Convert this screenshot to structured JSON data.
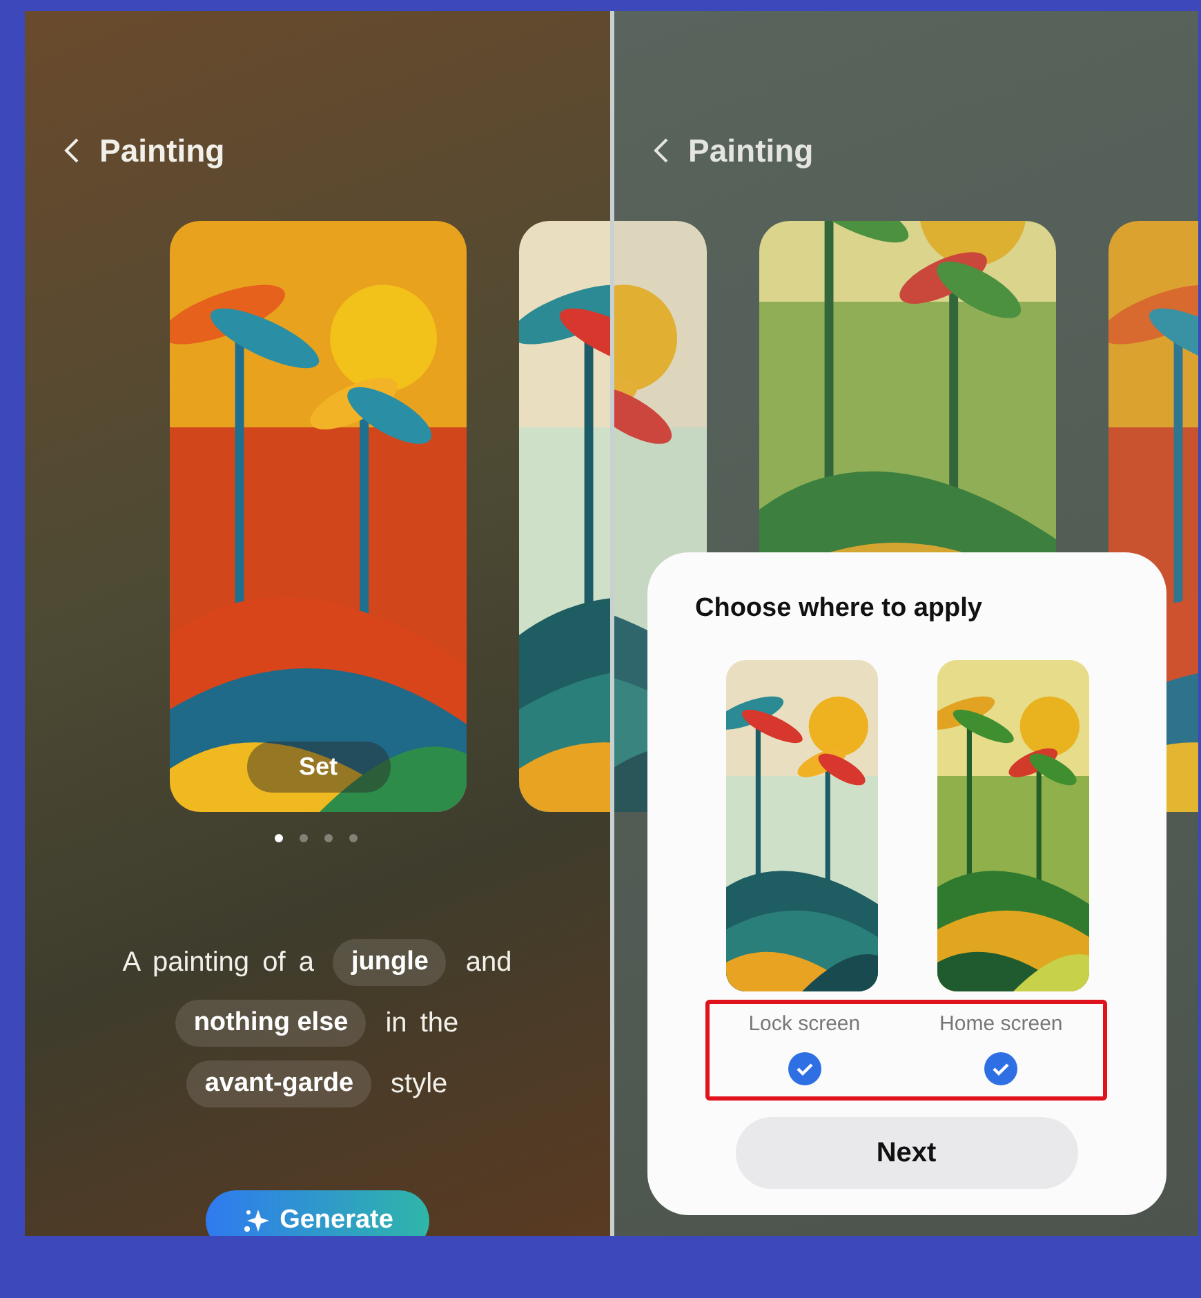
{
  "screens": [
    {
      "title": "Painting",
      "dimmed": false,
      "cards": [
        {
          "selected": true
        },
        {
          "selected": false
        }
      ],
      "set_button": "Set",
      "page_dots": [
        {
          "selected": true
        },
        {
          "selected": false
        },
        {
          "selected": false
        },
        {
          "selected": false
        }
      ],
      "prompt_lines": [
        [
          {
            "kind": "text",
            "text": "A painting of a"
          },
          {
            "kind": "chip",
            "text": "jungle"
          },
          {
            "kind": "text",
            "text": "and"
          }
        ],
        [
          {
            "kind": "chip",
            "text": "nothing else"
          },
          {
            "kind": "text",
            "text": "in the"
          }
        ],
        [
          {
            "kind": "chip",
            "text": "avant-garde"
          },
          {
            "kind": "text",
            "text": "style"
          }
        ]
      ],
      "generate_button": "Generate"
    },
    {
      "title": "Painting",
      "dimmed": true,
      "cards": [
        {
          "selected": false
        },
        {
          "selected": true
        },
        {
          "selected": false
        }
      ],
      "dialog": {
        "title": "Choose where to apply",
        "highlighted": true,
        "options": [
          {
            "label": "Lock screen",
            "checked": true
          },
          {
            "label": "Home screen",
            "checked": true
          }
        ],
        "button": "Next"
      }
    }
  ]
}
